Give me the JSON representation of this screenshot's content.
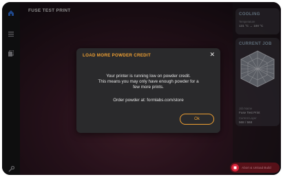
{
  "app": {
    "title": "FUSE TEST PRINT"
  },
  "sidebar": {
    "items": [
      {
        "name": "home-icon"
      },
      {
        "name": "menu-icon"
      },
      {
        "name": "documents-icon"
      },
      {
        "name": "wrench-icon"
      }
    ]
  },
  "cooling": {
    "title": "COOLING",
    "label": "Temperature",
    "value": "131 °C → 100 °C"
  },
  "current_job": {
    "title": "CURRENT JOB",
    "job_name_label": "Job Name",
    "job_name": "Fuse Test Print",
    "layer_label": "Current Layer",
    "layer_value": "568 / 568"
  },
  "abort_button": {
    "label": "Abort & Unload Build",
    "icon": "stop-icon"
  },
  "dialog": {
    "title": "LOAD MORE POWDER CREDIT",
    "body_line1": "Your printer is running low on powder credit.",
    "body_line2": "This means you may only have enough powder for a",
    "body_line3": "few more prints.",
    "order_text": "Order powder at: formlabs.com/store",
    "ok_label": "Ok"
  },
  "colors": {
    "accent": "#f2a233",
    "sidebar_active": "#2f6fd6",
    "abort": "#d8243a",
    "card_title": "#8fa6b8"
  }
}
